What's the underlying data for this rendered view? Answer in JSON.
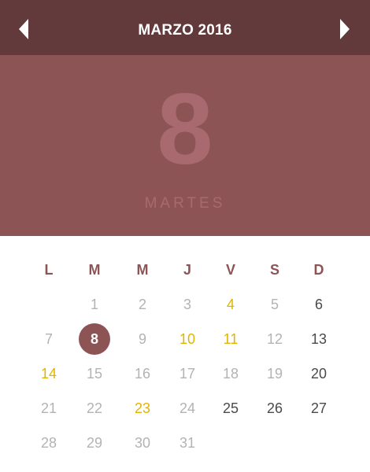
{
  "header": {
    "month_title": "MARZO 2016",
    "prev_icon": "chevron-left-icon",
    "next_icon": "chevron-right-icon"
  },
  "selected": {
    "day_number": "8",
    "weekday": "MARTES"
  },
  "weekdays": [
    "L",
    "M",
    "M",
    "J",
    "V",
    "S",
    "D"
  ],
  "weeks": [
    [
      "",
      "1",
      "2",
      "3",
      "4",
      "5",
      "6"
    ],
    [
      "7",
      "8",
      "9",
      "10",
      "11",
      "12",
      "13"
    ],
    [
      "14",
      "15",
      "16",
      "17",
      "18",
      "19",
      "20"
    ],
    [
      "21",
      "22",
      "23",
      "24",
      "25",
      "26",
      "27"
    ],
    [
      "28",
      "29",
      "30",
      "31",
      "",
      "",
      ""
    ]
  ],
  "colors": {
    "topbar": "#623a3c",
    "hero": "#8d5456",
    "hero_text": "#a86a6e",
    "weekday_header": "#8d5456",
    "highlight": "#e1b400",
    "muted_day": "#b3b3b3",
    "dark_day": "#4a4a4a",
    "selected_circle": "#8d5456"
  }
}
